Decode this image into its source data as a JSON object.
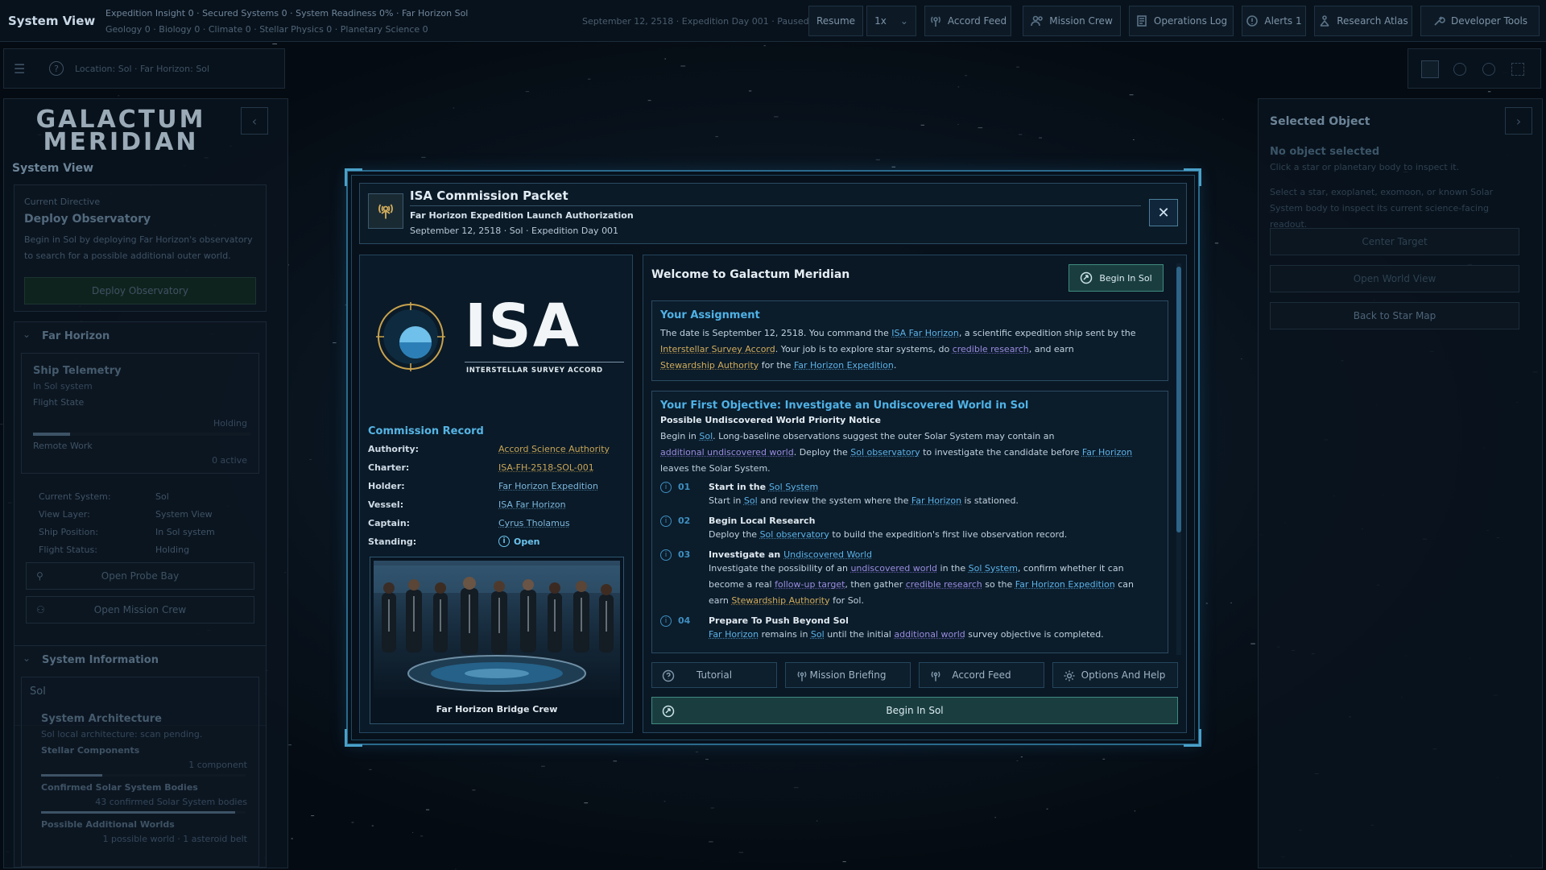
{
  "app": {
    "title": "System View"
  },
  "topbar": {
    "stats_line1": "Expedition Insight 0 · Secured Systems 0 · System Readiness 0% · Far Horizon Sol",
    "stats_line2": "Geology 0 · Biology 0 · Climate 0 · Stellar Physics 0 · Planetary Science 0",
    "date_status": "September 12, 2518 · Expedition Day 001 · Paused",
    "resume_label": "Resume",
    "speed_value": "1x",
    "buttons": [
      "Accord Feed",
      "Mission Crew",
      "Operations Log",
      "Alerts 1",
      "Research Atlas",
      "Developer Tools"
    ]
  },
  "location_bar": {
    "text": "Location: Sol · Far Horizon: Sol"
  },
  "left_panel": {
    "logo_line1": "GALACTUM",
    "logo_line2": "MERIDIAN",
    "view_title": "System View",
    "directive": {
      "label": "Current Directive",
      "title": "Deploy Observatory",
      "text": "Begin in Sol by deploying Far Horizon's observatory to search for a possible additional outer world.",
      "button": "Deploy Observatory"
    },
    "far_horizon": {
      "header": "Far Horizon",
      "telemetry_title": "Ship Telemetry",
      "telemetry_sub": "In Sol system",
      "flight_state_label": "Flight State",
      "flight_state_value": "Holding",
      "flight_state_fill": 0.17,
      "remote_work_label": "Remote Work",
      "remote_work_value": "0 active",
      "fields": [
        {
          "k": "Current System:",
          "v": "Sol"
        },
        {
          "k": "View Layer:",
          "v": "System View"
        },
        {
          "k": "Ship Position:",
          "v": "In Sol system"
        },
        {
          "k": "Flight Status:",
          "v": "Holding"
        }
      ],
      "open_probe_bay": "Open Probe Bay",
      "open_mission_crew": "Open Mission Crew"
    },
    "system_info": {
      "header": "System Information",
      "system_name": "Sol",
      "arch_title": "System Architecture",
      "arch_sub": "Sol local architecture: scan pending.",
      "stellar_label": "Stellar Components",
      "stellar_value": "1 component",
      "stellar_fill": 0.3,
      "bodies_label": "Confirmed Solar System Bodies",
      "bodies_value": "43 confirmed Solar System bodies",
      "bodies_fill": 0.95,
      "worlds_label": "Possible Additional Worlds",
      "worlds_value": "1 possible world · 1 asteroid belt"
    }
  },
  "right_panel": {
    "title": "Selected Object",
    "none_title": "No object selected",
    "none_sub": "Click a star or planetary body to inspect it.",
    "help": "Select a star, exoplanet, exomoon, or known Solar System body to inspect its current science-facing readout.",
    "btn_center": "Center Target",
    "btn_world": "Open World View",
    "btn_back": "Back to Star Map"
  },
  "modal": {
    "title": "ISA Commission Packet",
    "subtitle": "Far Horizon Expedition Launch Authorization",
    "date": "September 12, 2518 · Sol · Expedition Day 001",
    "close": "✕",
    "logo_text": "ISA",
    "logo_caption": "INTERSTELLAR SURVEY ACCORD",
    "record_title": "Commission Record",
    "record": [
      {
        "k": "Authority:",
        "v": "Accord Science Authority"
      },
      {
        "k": "Charter:",
        "v": "ISA-FH-2518-SOL-001"
      },
      {
        "k": "Holder:",
        "v": "Far Horizon Expedition"
      },
      {
        "k": "Vessel:",
        "v": "ISA Far Horizon"
      },
      {
        "k": "Captain:",
        "v": "Cyrus Tholamus"
      },
      {
        "k": "Standing:",
        "v": "Open"
      }
    ],
    "crew_caption": "Far Horizon Bridge Crew",
    "welcome_title": "Welcome to Galactum Meridian",
    "begin_label": "Begin In Sol",
    "assignment": {
      "title": "Your Assignment",
      "l1a": "The date is September 12, 2518. You command the ",
      "l1b": "ISA Far Horizon",
      "l1c": ", a scientific expedition ship sent by the",
      "l2a": "Interstellar Survey Accord",
      "l2b": ". Your job is to explore star systems, do ",
      "l2c": "credible research",
      "l2d": ", and earn",
      "l3a": "Stewardship Authority",
      "l3b": " for the ",
      "l3c": "Far Horizon Expedition",
      "l3d": "."
    },
    "objective": {
      "title": "Your First Objective: Investigate an Undiscovered World in Sol",
      "notice": "Possible Undiscovered World Priority Notice",
      "p1a": "Begin in ",
      "p1b": "Sol",
      "p1c": ". Long-baseline observations suggest the outer Solar System may contain an",
      "p2a": "additional undiscovered world",
      "p2b": ". Deploy the ",
      "p2c": "Sol observatory",
      "p2d": " to investigate the candidate before ",
      "p2e": "Far Horizon",
      "p3": "leaves the Solar System.",
      "steps": [
        {
          "n": "01",
          "t1": "Start in the ",
          "t2": "Sol System",
          "d1": "Start in ",
          "d2": "Sol",
          "d3": " and review the system where the ",
          "d4": "Far Horizon",
          "d5": " is stationed."
        },
        {
          "n": "02",
          "t1": "Begin Local Research",
          "d1": "Deploy the ",
          "d2": "Sol observatory",
          "d3": " to build the expedition's first live observation record."
        },
        {
          "n": "03",
          "t1": "Investigate an ",
          "t2": "Undiscovered World"
        },
        {
          "n": "04",
          "t1": "Prepare To Push Beyond Sol",
          "d1": "Far Horizon",
          "d2": " remains in ",
          "d3": "Sol",
          "d4": " until the initial ",
          "d5": "additional world",
          "d6": " survey objective is completed."
        }
      ],
      "s3_l1a": "Investigate the possibility of an ",
      "s3_l1b": "undiscovered world",
      "s3_l1c": " in the ",
      "s3_l1d": "Sol System",
      "s3_l1e": ", confirm whether it can",
      "s3_l2a": "become a real ",
      "s3_l2b": "follow-up target",
      "s3_l2c": ", then gather ",
      "s3_l2d": "credible research",
      "s3_l2e": " so the ",
      "s3_l2f": "Far Horizon Expedition",
      "s3_l2g": " can",
      "s3_l3a": "earn ",
      "s3_l3b": "Stewardship Authority",
      "s3_l3c": " for Sol."
    },
    "footer": {
      "tutorial": "Tutorial",
      "briefing": "Mission Briefing",
      "feed": "Accord Feed",
      "options": "Options And Help",
      "begin": "Begin In Sol"
    }
  },
  "colors": {
    "accent": "#4fb2e6",
    "gold": "#d2ad5b",
    "purple": "#9a8ce0",
    "frame": "#2a6a8c",
    "begin_bg": "#1d4a4c"
  }
}
